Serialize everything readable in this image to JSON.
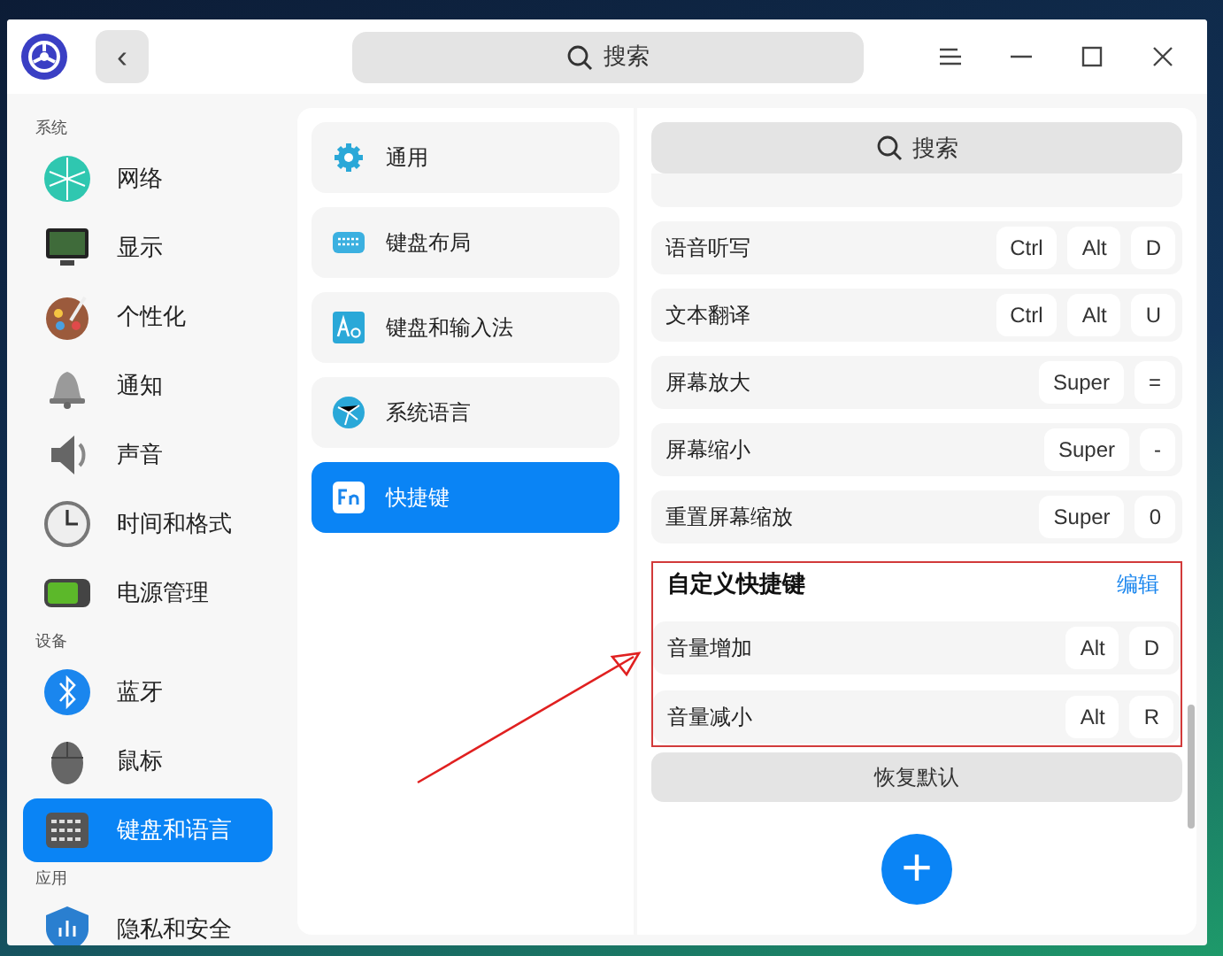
{
  "titlebar": {
    "back": "‹",
    "search": {
      "placeholder": "搜索"
    }
  },
  "sidebar": {
    "sections": [
      {
        "title": "系统",
        "items": [
          {
            "label": "网络",
            "selected": false
          },
          {
            "label": "显示",
            "selected": false
          },
          {
            "label": "个性化",
            "selected": false
          },
          {
            "label": "通知",
            "selected": false
          },
          {
            "label": "声音",
            "selected": false
          },
          {
            "label": "时间和格式",
            "selected": false
          },
          {
            "label": "电源管理",
            "selected": false
          }
        ]
      },
      {
        "title": "设备",
        "items": [
          {
            "label": "蓝牙",
            "selected": false
          },
          {
            "label": "鼠标",
            "selected": false
          },
          {
            "label": "键盘和语言",
            "selected": true
          }
        ]
      },
      {
        "title": "应用",
        "items": [
          {
            "label": "隐私和安全",
            "selected": false
          }
        ]
      }
    ]
  },
  "categories": [
    {
      "label": "通用",
      "selected": false
    },
    {
      "label": "键盘布局",
      "selected": false
    },
    {
      "label": "键盘和输入法",
      "selected": false
    },
    {
      "label": "系统语言",
      "selected": false
    },
    {
      "label": "快捷键",
      "selected": true
    }
  ],
  "shortcuts": {
    "search": {
      "placeholder": "搜索"
    },
    "rows": [
      {
        "label": "语音听写",
        "keys": [
          "Ctrl",
          "Alt",
          "D"
        ]
      },
      {
        "label": "文本翻译",
        "keys": [
          "Ctrl",
          "Alt",
          "U"
        ]
      },
      {
        "label": "屏幕放大",
        "keys": [
          "Super",
          "="
        ]
      },
      {
        "label": "屏幕缩小",
        "keys": [
          "Super",
          "-"
        ]
      },
      {
        "label": "重置屏幕缩放",
        "keys": [
          "Super",
          "0"
        ]
      }
    ],
    "custom": {
      "title": "自定义快捷键",
      "action": "编辑",
      "annotated": true,
      "rows": [
        {
          "label": "音量增加",
          "keys": [
            "Alt",
            "D"
          ]
        },
        {
          "label": "音量减小",
          "keys": [
            "Alt",
            "R"
          ]
        }
      ]
    },
    "restore_button": "恢复默认",
    "add_button": "+"
  }
}
